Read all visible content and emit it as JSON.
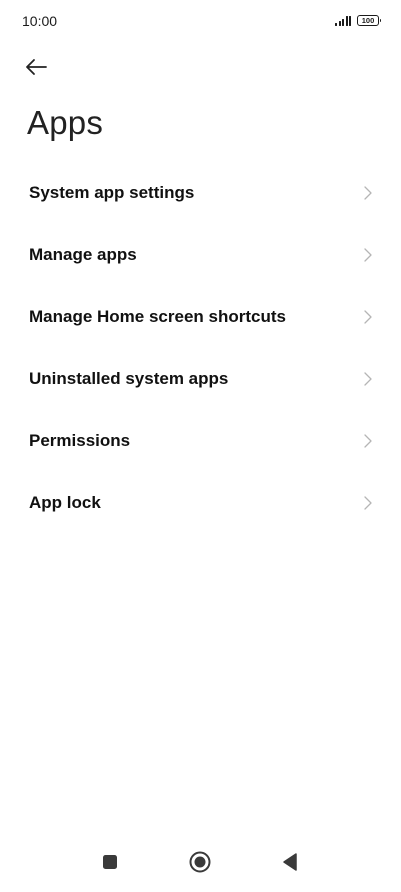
{
  "status_bar": {
    "time": "10:00",
    "battery_level": "100"
  },
  "header": {
    "title": "Apps"
  },
  "menu": {
    "items": [
      {
        "label": "System app settings"
      },
      {
        "label": "Manage apps"
      },
      {
        "label": "Manage Home screen shortcuts"
      },
      {
        "label": "Uninstalled system apps"
      },
      {
        "label": "Permissions"
      },
      {
        "label": "App lock"
      }
    ]
  },
  "icons": {
    "back": "arrow-left-icon",
    "chevron": "chevron-right-icon",
    "signal": "signal-icon",
    "battery": "battery-icon",
    "nav_recents": "square-icon",
    "nav_home": "circle-icon",
    "nav_back": "triangle-back-icon"
  },
  "colors": {
    "background": "#ffffff",
    "text": "#111111",
    "chevron": "#b5b5b5",
    "nav": "#3a3a3a"
  }
}
